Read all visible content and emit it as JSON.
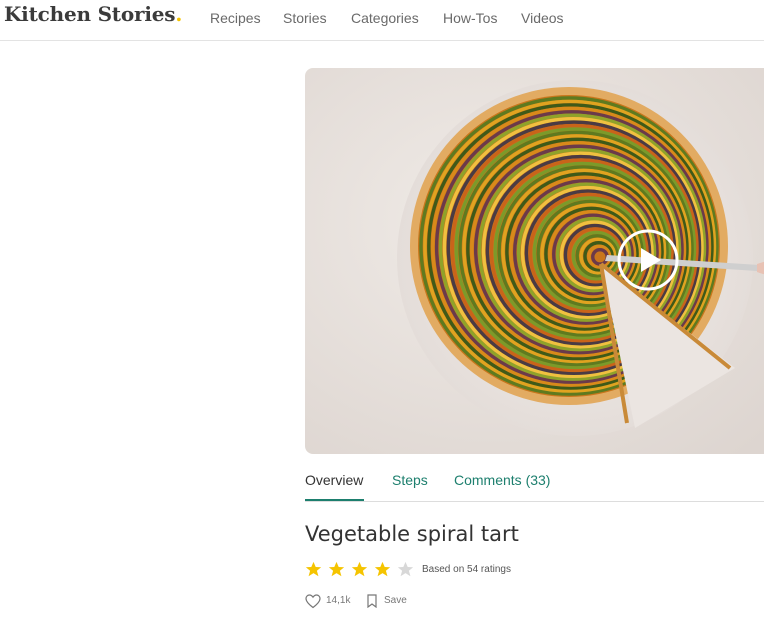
{
  "header": {
    "logo_text": "Kitchen Stories",
    "logo_dot": ".",
    "nav": [
      "Recipes",
      "Stories",
      "Categories",
      "How-Tos",
      "Videos"
    ]
  },
  "hero": {
    "play_icon": "play-icon",
    "accent": "#ffffff"
  },
  "tabs": {
    "items": [
      "Overview",
      "Steps",
      "Comments (33)"
    ],
    "active": "Overview",
    "accent": "#1d7f6e"
  },
  "recipe": {
    "title": "Vegetable spiral tart",
    "rating_value": 4,
    "rating_max": 5,
    "rating_text": "Based on 54 ratings",
    "star_color": "#f5c400",
    "star_empty_color": "#d8d8d8",
    "likes": "14,1k",
    "like_icon": "heart-icon",
    "save_label": "Save",
    "save_icon": "bookmark-icon"
  }
}
